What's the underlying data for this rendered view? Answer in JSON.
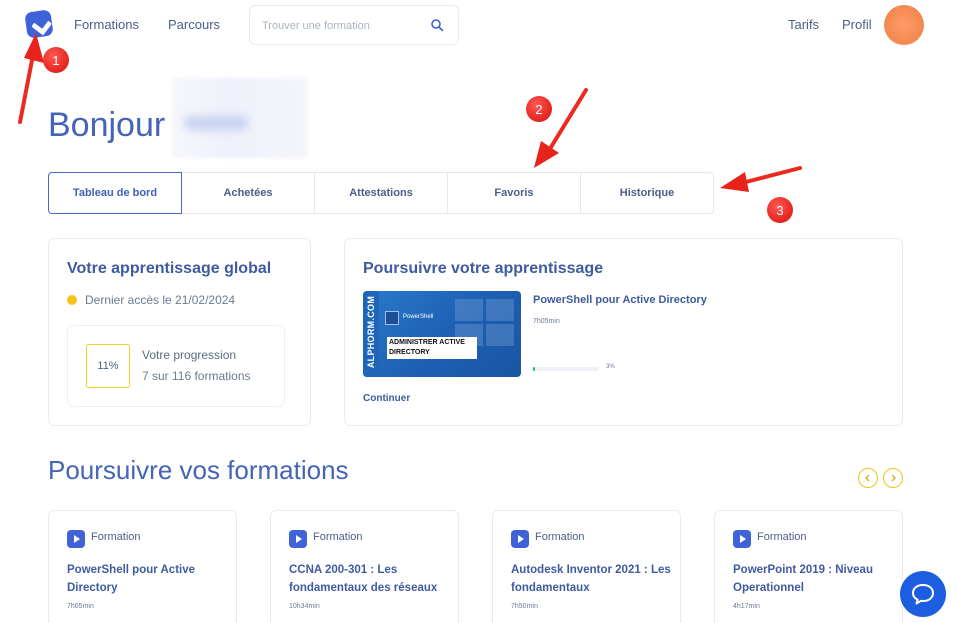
{
  "header": {
    "nav": [
      "Formations",
      "Parcours"
    ],
    "search_placeholder": "Trouver une formation",
    "right_links": [
      "Tarifs",
      "Profil"
    ]
  },
  "greeting": "Bonjour",
  "tabs": [
    {
      "label": "Tableau de bord",
      "active": true
    },
    {
      "label": "Achetées",
      "active": false
    },
    {
      "label": "Attestations",
      "active": false
    },
    {
      "label": "Favoris",
      "active": false
    },
    {
      "label": "Historique",
      "active": false
    }
  ],
  "global_learning": {
    "title": "Votre apprentissage global",
    "last_access": "Dernier accès le 21/02/2024",
    "percent": "11%",
    "progress_label": "Votre progression",
    "progress_count": "7 sur 116 formations"
  },
  "continue_learning": {
    "title": "Poursuivre votre apprentissage",
    "thumbnail": {
      "vertical_text": "ALPHORM.COM",
      "product": "PowerShell",
      "caption": "ADMINISTRER ACTIVE DIRECTORY"
    },
    "course_title": "PowerShell pour Active Directory",
    "duration": "7h05min",
    "progress": 0.03,
    "progress_text": "3%",
    "link": "Continuer"
  },
  "formations_section": {
    "title": "Poursuivre vos formations",
    "cards": [
      {
        "type": "Formation",
        "title": "PowerShell pour Active Directory",
        "duration": "7h05min"
      },
      {
        "type": "Formation",
        "title": "CCNA 200-301 : Les fondamentaux des réseaux",
        "duration": "10h34min"
      },
      {
        "type": "Formation",
        "title": "Autodesk Inventor 2021 : Les fondamentaux",
        "duration": "7h50min"
      },
      {
        "type": "Formation",
        "title": "PowerPoint 2019 : Niveau Operationnel",
        "duration": "4h17min"
      }
    ]
  },
  "markers": [
    "1",
    "2",
    "3"
  ],
  "colors": {
    "brand": "#3f62d8",
    "heading": "#4564b8",
    "accent_yellow": "#f3c315",
    "annotation_red": "#e82a24",
    "progress_green": "#1fbf6e"
  }
}
